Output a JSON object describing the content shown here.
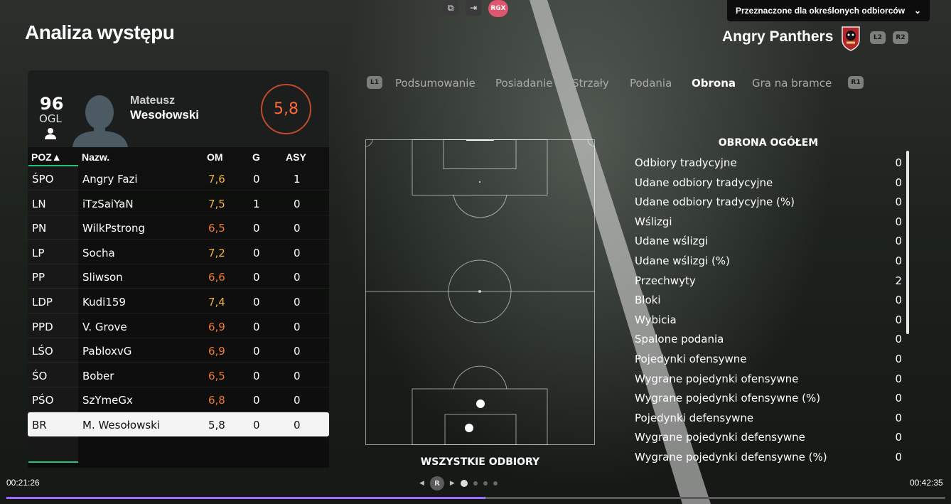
{
  "window": {
    "audience_label": "Przeznaczone dla określonych odbiorców",
    "top_icons": [
      "duplicate-icon",
      "exit-icon"
    ],
    "rgx_badge": "RGX"
  },
  "header": {
    "title": "Analiza występu",
    "team_name": "Angry Panthers",
    "l2": "L2",
    "r2": "R2"
  },
  "player": {
    "ovr": "96",
    "ovr_label": "OGL",
    "first_name": "Mateusz",
    "last_name": "Wesołowski",
    "rating": "5,8"
  },
  "table": {
    "headers": {
      "pos": "POZ▲",
      "name": "Nazw.",
      "om": "OM",
      "g": "G",
      "asy": "ASY"
    },
    "rows": [
      {
        "pos": "ŚPO",
        "name": "Angry Fazi",
        "om": "7,6",
        "g": "0",
        "asy": "1",
        "om_color": "#f2b33a"
      },
      {
        "pos": "LN",
        "name": "iTzSaiYaN",
        "om": "7,5",
        "g": "1",
        "asy": "0",
        "om_color": "#f2b33a"
      },
      {
        "pos": "PN",
        "name": "WilkPstrong",
        "om": "6,5",
        "g": "0",
        "asy": "0",
        "om_color": "#f07a2e"
      },
      {
        "pos": "LP",
        "name": "Socha",
        "om": "7,2",
        "g": "0",
        "asy": "0",
        "om_color": "#f2b33a"
      },
      {
        "pos": "PP",
        "name": "Sliwson",
        "om": "6,6",
        "g": "0",
        "asy": "0",
        "om_color": "#f07a2e"
      },
      {
        "pos": "LDP",
        "name": "Kudi159",
        "om": "7,4",
        "g": "0",
        "asy": "0",
        "om_color": "#f2b33a"
      },
      {
        "pos": "PPD",
        "name": "V. Grove",
        "om": "6,9",
        "g": "0",
        "asy": "0",
        "om_color": "#f07a2e"
      },
      {
        "pos": "LŚO",
        "name": "PabloxvG",
        "om": "6,9",
        "g": "0",
        "asy": "0",
        "om_color": "#f07a2e"
      },
      {
        "pos": "ŚO",
        "name": "Bober",
        "om": "6,5",
        "g": "0",
        "asy": "0",
        "om_color": "#f07a2e"
      },
      {
        "pos": "PŚO",
        "name": "SzYmeGx",
        "om": "6,8",
        "g": "0",
        "asy": "0",
        "om_color": "#f07a2e"
      },
      {
        "pos": "BR",
        "name": "M. Wesołowski",
        "om": "5,8",
        "g": "0",
        "asy": "0",
        "om_color": "#111111",
        "selected": true
      }
    ]
  },
  "tabs": {
    "l1": "L1",
    "r1": "R1",
    "items": [
      "Podsumowanie",
      "Posiadanie",
      "Strzały",
      "Podania",
      "Obrona",
      "Gra na bramce"
    ],
    "active": "Obrona"
  },
  "pitch": {
    "caption": "WSZYSTKIE ODBIORY"
  },
  "stats": {
    "title": "OBRONA OGÓŁEM",
    "items": [
      {
        "label": "Odbiory tradycyjne",
        "value": "0"
      },
      {
        "label": "Udane odbiory tradycyjne",
        "value": "0"
      },
      {
        "label": "Udane odbiory tradycyjne (%)",
        "value": "0"
      },
      {
        "label": "Wślizgi",
        "value": "0"
      },
      {
        "label": "Udane wślizgi",
        "value": "0"
      },
      {
        "label": "Udane wślizgi (%)",
        "value": "0"
      },
      {
        "label": "Przechwyty",
        "value": "2"
      },
      {
        "label": "Bloki",
        "value": "0"
      },
      {
        "label": "Wybicia",
        "value": "0"
      },
      {
        "label": "Spalone podania",
        "value": "0"
      },
      {
        "label": "Pojedynki ofensywne",
        "value": "0"
      },
      {
        "label": "Wygrane pojedynki ofensywne",
        "value": "0"
      },
      {
        "label": "Wygrane pojedynki ofensywne (%)",
        "value": "0"
      },
      {
        "label": "Pojedynki defensywne",
        "value": "0"
      },
      {
        "label": "Wygrane pojedynki defensywne",
        "value": "0"
      },
      {
        "label": "Wygrane pojedynki defensywne (%)",
        "value": "0"
      }
    ]
  },
  "player_bar": {
    "current_time": "00:21:26",
    "total_time": "00:42:35",
    "progress": 0.51,
    "pager_button": "R"
  }
}
